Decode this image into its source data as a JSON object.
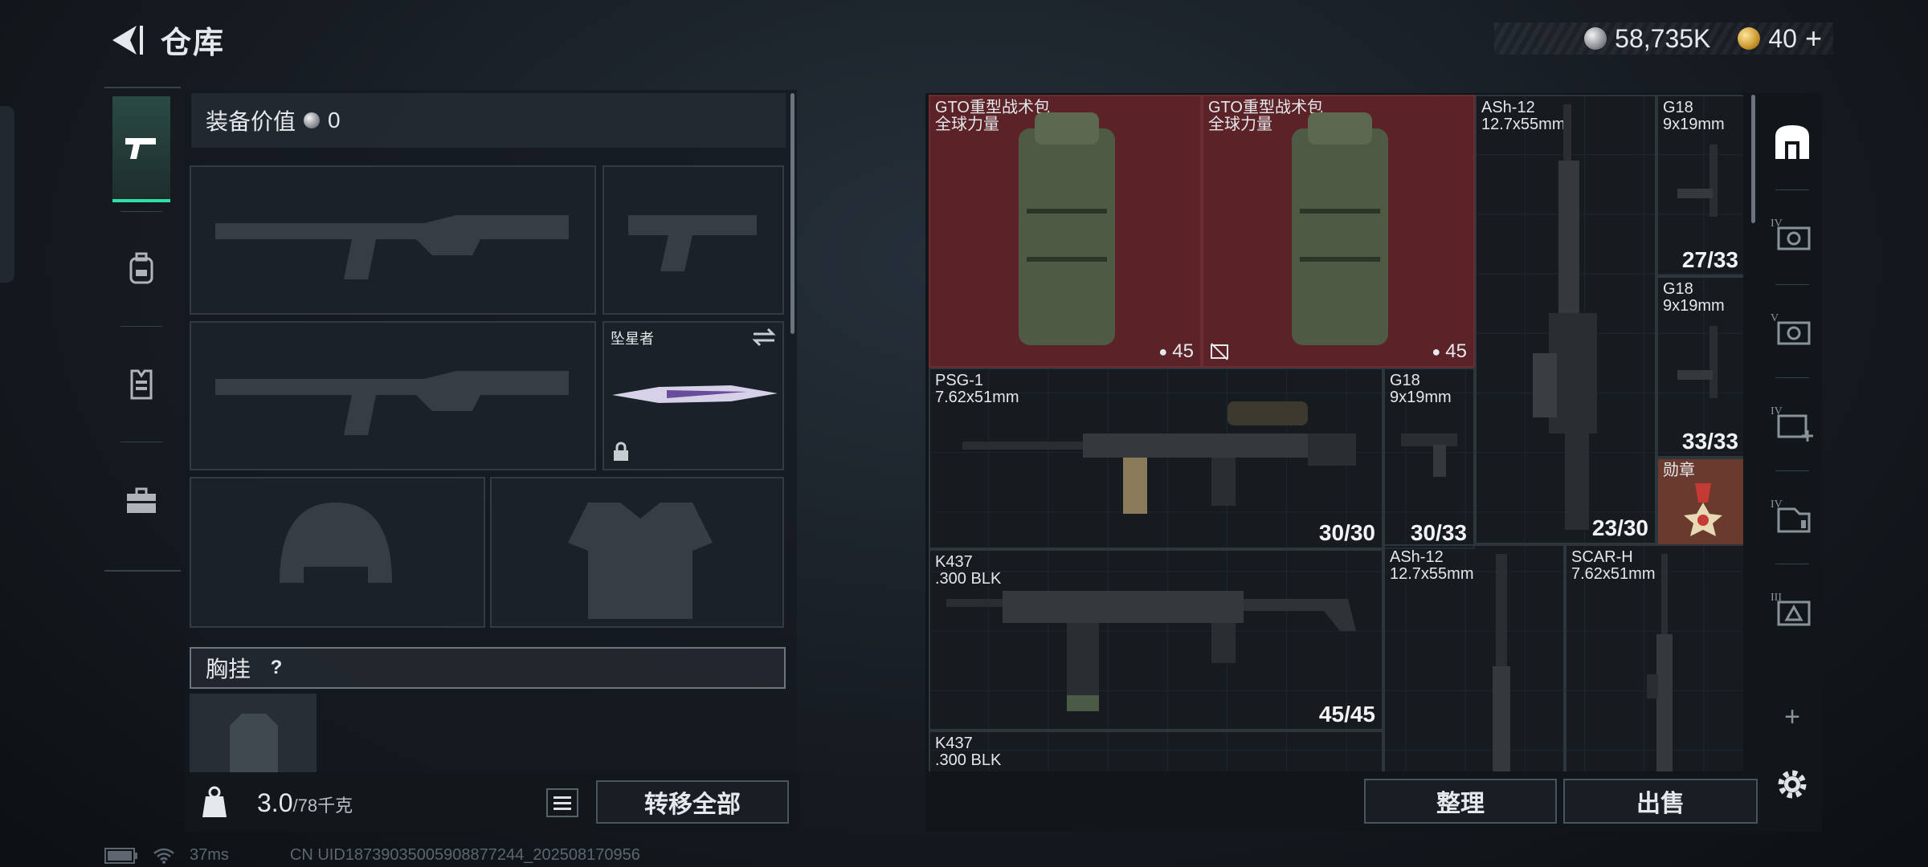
{
  "header": {
    "title": "仓库"
  },
  "currency": {
    "money": "58,735K",
    "tokens": "40",
    "plus": "+"
  },
  "tabs": [
    "weapons",
    "backpack",
    "vest",
    "toolbox"
  ],
  "equipment": {
    "label": "装备价值",
    "value": "0"
  },
  "special_slot": {
    "name": "坠星者"
  },
  "chest": {
    "label": "胸挂",
    "help": "?"
  },
  "weight": {
    "current": "3.0",
    "capacity": "/78千克"
  },
  "actions": {
    "transfer_all": "转移全部",
    "sort": "整理",
    "sell": "出售"
  },
  "stash": {
    "items": [
      {
        "name": "GTO重型战术包",
        "sub": "全球力量",
        "badge": "45"
      },
      {
        "name": "GTO重型战术包",
        "sub": "全球力量",
        "badge": "45"
      },
      {
        "name": "ASh-12",
        "sub": "12.7x55mm",
        "count": "23/30"
      },
      {
        "name": "G18",
        "sub": "9x19mm",
        "count": "27/33"
      },
      {
        "name": "G18",
        "sub": "9x19mm",
        "count": "33/33"
      },
      {
        "name": "PSG-1",
        "sub": "7.62x51mm",
        "count": "30/30"
      },
      {
        "name": "G18",
        "sub": "9x19mm",
        "count": "30/33"
      },
      {
        "name": "勋章",
        "sub": ""
      },
      {
        "name": "K437",
        "sub": ".300 BLK",
        "count": "45/45"
      },
      {
        "name": "ASh-12",
        "sub": "12.7x55mm",
        "count": ""
      },
      {
        "name": "SCAR-H",
        "sub": "7.62x51mm",
        "count": ""
      },
      {
        "name": "K437",
        "sub": ".300 BLK",
        "count": ""
      }
    ]
  },
  "sidebar_right": {
    "tier_labels": [
      "IV",
      "V",
      "IV",
      "IV",
      "III"
    ],
    "add": "+"
  },
  "footer": {
    "ping": "37ms",
    "uid": "CN UID18739035005908877244_202508170956"
  },
  "colors": {
    "accent": "#2fe0a8",
    "item_red": "#5b2228",
    "item_medal": "#6a3a2e"
  }
}
